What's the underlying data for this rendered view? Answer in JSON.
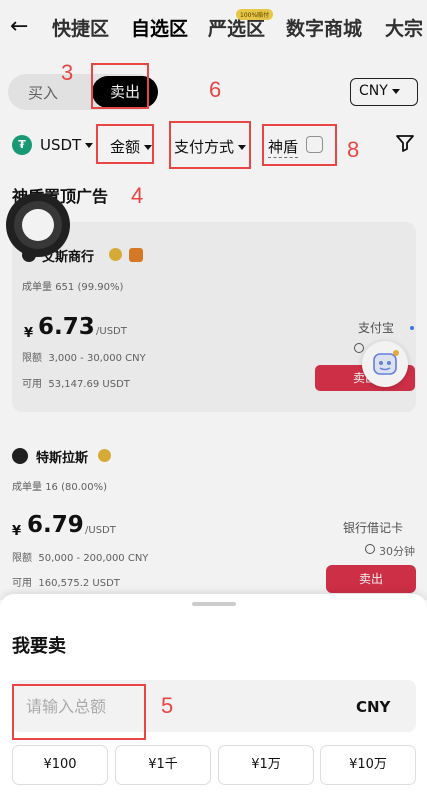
{
  "nav": {
    "back_icon": "arrow-left-icon",
    "tabs": [
      "快捷区",
      "自选区",
      "严选区",
      "数字商城",
      "大宗"
    ],
    "active_tab": "自选区",
    "badge": "100%赔付"
  },
  "trade_toggle": {
    "buy": "买入",
    "sell": "卖出",
    "selected": "卖出"
  },
  "currency": {
    "selected": "CNY"
  },
  "filters": {
    "asset": "USDT",
    "asset_icon_glyph": "₮",
    "amount": "金额",
    "payment": "支付方式",
    "shield": "神盾",
    "filter_icon": "funnel-icon"
  },
  "section": {
    "title": "神盾置顶广告"
  },
  "ads": [
    {
      "merchant": "艾斯商行",
      "orders_label": "成单量",
      "orders": "651 (99.90%)",
      "currency_sign": "¥",
      "price": "6.73",
      "unit": "/USDT",
      "limit_label": "限额",
      "limit": "3,000 - 30,000 CNY",
      "available_label": "可用",
      "available": "53,147.69 USDT",
      "payment_method": "支付宝",
      "action": "卖出"
    },
    {
      "merchant": "特斯拉斯",
      "orders_label": "成单量",
      "orders": "16 (80.00%)",
      "currency_sign": "¥",
      "price": "6.79",
      "unit": "/USDT",
      "limit_label": "限额",
      "limit": "50,000 - 200,000 CNY",
      "available_label": "可用",
      "available": "160,575.2 USDT",
      "payment_method": "银行借记卡",
      "time": "30分钟",
      "action": "卖出"
    }
  ],
  "sheet": {
    "title": "我要卖",
    "amount_placeholder": "请输入总额",
    "amount_value": "",
    "currency": "CNY",
    "quick_amounts": [
      "¥100",
      "¥1千",
      "¥1万",
      "¥10万"
    ]
  },
  "annotations": {
    "a3": "3",
    "a4": "4",
    "a5": "5",
    "a6": "6",
    "a8": "8"
  },
  "colors": {
    "accent_red": "#d9324a",
    "annotation_red": "#e84545",
    "usdt_green": "#1ba27a"
  }
}
